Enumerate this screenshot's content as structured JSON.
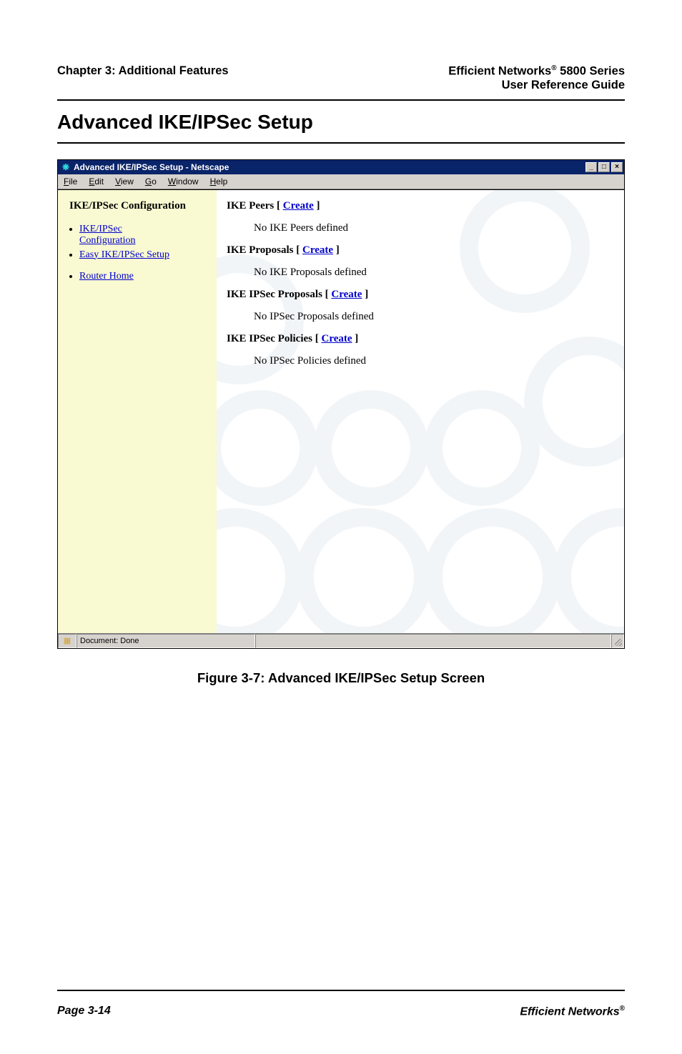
{
  "header": {
    "left": "Chapter 3: Additional Features",
    "right_line1_a": "Efficient Networks",
    "right_line1_b": " 5800 Series",
    "right_line2": "User Reference Guide",
    "reg": "®"
  },
  "section_title": "Advanced IKE/IPSec Setup",
  "window": {
    "title": "Advanced IKE/IPSec Setup - Netscape",
    "icon_glyph": "❋",
    "btn_min": "_",
    "btn_max": "□",
    "btn_close": "×",
    "menu": {
      "file": "File",
      "file_u": "F",
      "edit": "Edit",
      "edit_u": "E",
      "view": "View",
      "view_u": "V",
      "go": "Go",
      "go_u": "G",
      "window": "Window",
      "window_u": "W",
      "help": "Help",
      "help_u": "H"
    }
  },
  "sidebar": {
    "title": "IKE/IPSec Configuration",
    "items": [
      {
        "label_a": "IKE/IPSec",
        "label_b": "Configuration"
      },
      {
        "label_a": "Easy IKE/IPSec Setup"
      },
      {
        "label_a": "Router Home"
      }
    ]
  },
  "main": {
    "sections": [
      {
        "heading_prefix": "IKE Peers [ ",
        "heading_link": "Create",
        "heading_suffix": " ]",
        "body": "No IKE Peers defined"
      },
      {
        "heading_prefix": "IKE Proposals [ ",
        "heading_link": "Create",
        "heading_suffix": " ]",
        "body": "No IKE Proposals defined"
      },
      {
        "heading_prefix": "IKE IPSec Proposals [ ",
        "heading_link": "Create",
        "heading_suffix": " ]",
        "body": "No IPSec Proposals defined"
      },
      {
        "heading_prefix": "IKE IPSec Policies [ ",
        "heading_link": "Create",
        "heading_suffix": " ]",
        "body": "No IPSec Policies defined"
      }
    ]
  },
  "statusbar": {
    "icon_glyph": "▦",
    "message": "Document: Done"
  },
  "caption": "Figure 3-7:  Advanced IKE/IPSec Setup Screen",
  "footer": {
    "left": "Page 3-14",
    "right_a": "Efficient Networks",
    "reg": "®"
  }
}
